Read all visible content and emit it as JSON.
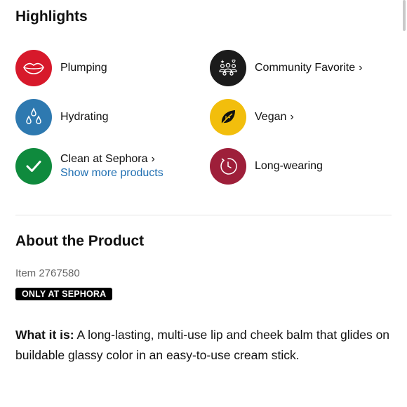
{
  "highlights": {
    "title": "Highlights",
    "items": [
      {
        "label": "Plumping",
        "icon": "lips-icon",
        "color": "#D7192B"
      },
      {
        "label": "Community Favorite",
        "chevron": "›",
        "icon": "community-icon",
        "color": "#1B1B1B"
      },
      {
        "label": "Hydrating",
        "icon": "water-drops-icon",
        "color": "#2E79B0"
      },
      {
        "label": "Vegan",
        "chevron": "›",
        "icon": "leaf-icon",
        "color": "#F2BE0C"
      },
      {
        "label": "Clean at Sephora",
        "chevron": "›",
        "link": "Show more products",
        "icon": "checkmark-icon",
        "color": "#0F8A3D"
      },
      {
        "label": "Long-wearing",
        "icon": "clock-icon",
        "color": "#9E1F3A"
      }
    ]
  },
  "about": {
    "title": "About the Product",
    "item_number": "Item 2767580",
    "badge": "ONLY AT SEPHORA",
    "what_label": "What it is:",
    "what_text": " A long-lasting, multi-use lip and cheek balm that glides on buildable glassy color in an easy-to-use cream stick."
  }
}
